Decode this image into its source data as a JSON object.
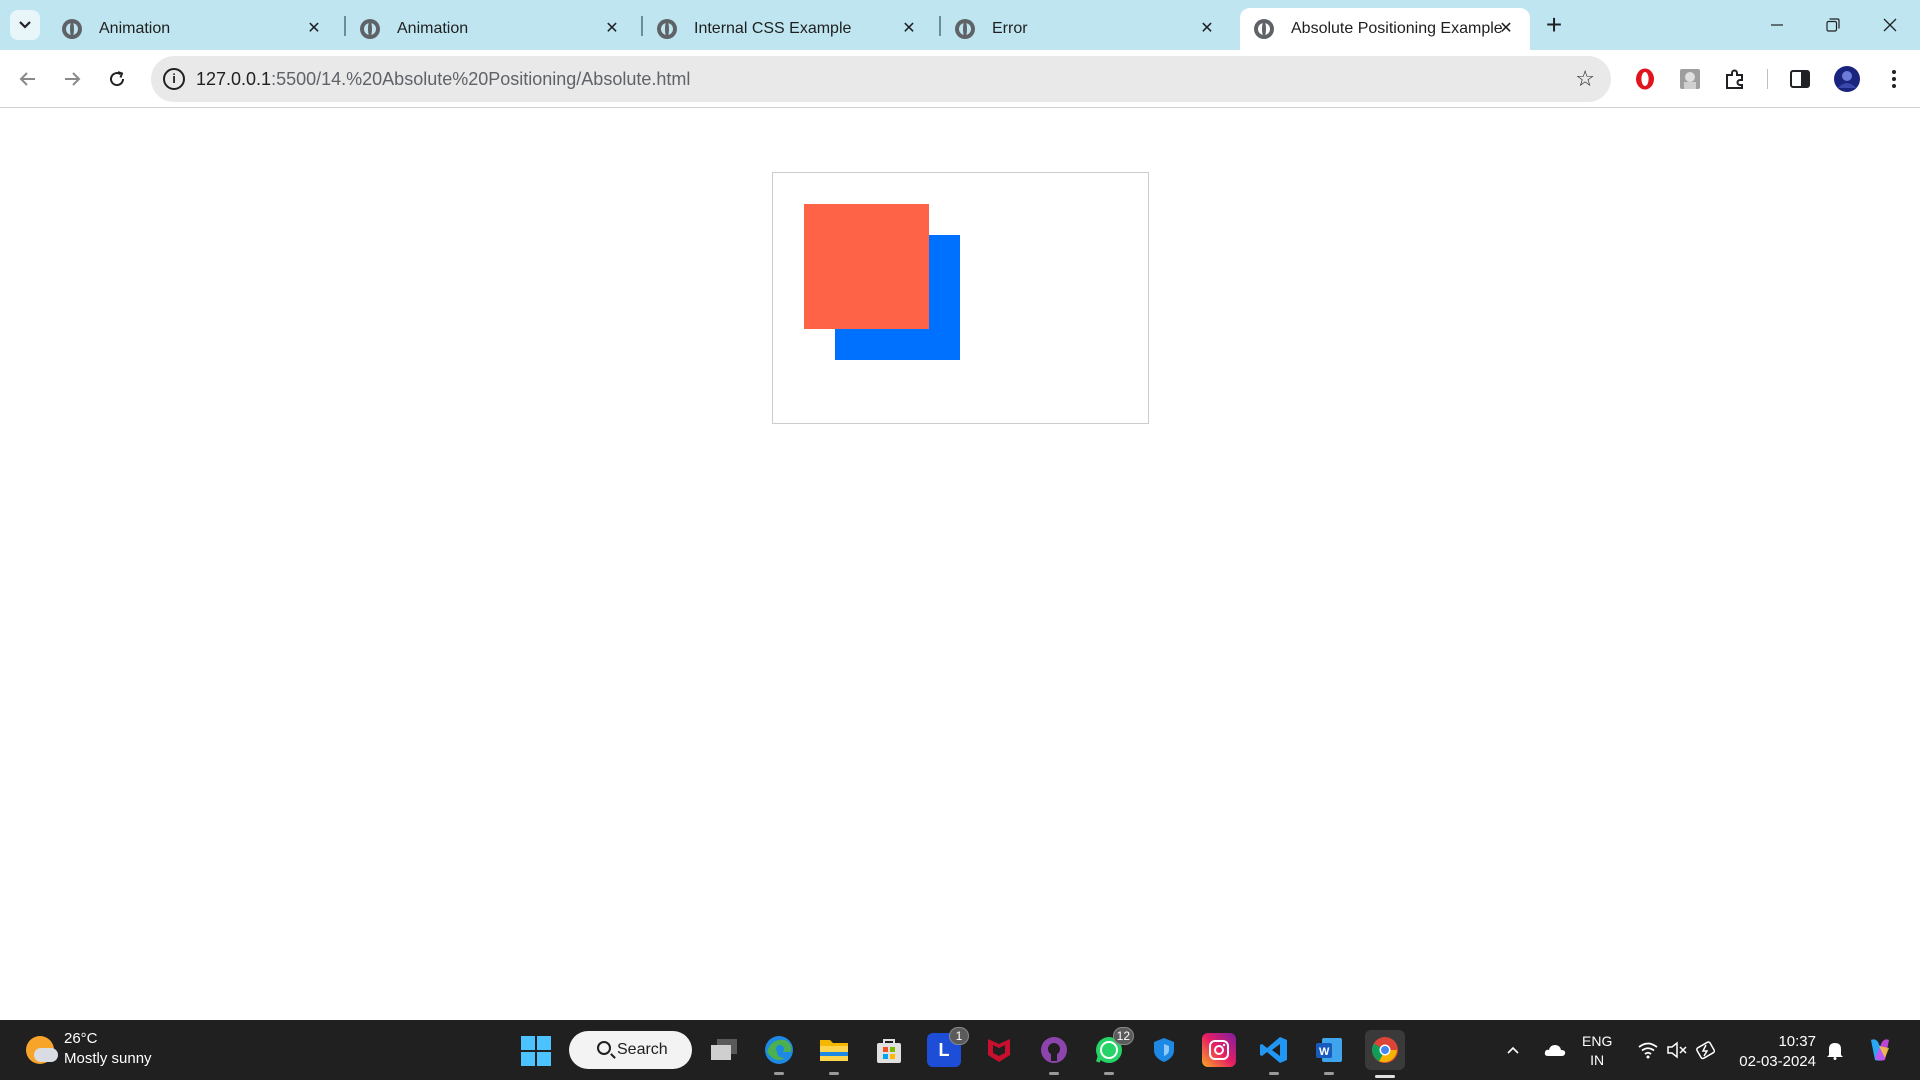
{
  "browser": {
    "tabs": [
      {
        "title": "Animation",
        "active": false
      },
      {
        "title": "Animation",
        "active": false
      },
      {
        "title": "Internal CSS Example",
        "active": false
      },
      {
        "title": "Error",
        "active": false
      },
      {
        "title": "Absolute Positioning Example",
        "active": true
      }
    ],
    "new_tab_label": "+",
    "address": {
      "host": "127.0.0.1",
      "path": ":5500/14.%20Absolute%20Positioning/Absolute.html"
    }
  },
  "page": {
    "front_box_color": "#ff6347",
    "back_box_color": "#0070ff"
  },
  "taskbar": {
    "weather": {
      "temp": "26°C",
      "desc": "Mostly sunny"
    },
    "search_label": "Search",
    "apps": [
      {
        "name": "task-view",
        "badge": ""
      },
      {
        "name": "edge",
        "badge": ""
      },
      {
        "name": "file-explorer",
        "badge": ""
      },
      {
        "name": "microsoft-store",
        "badge": ""
      },
      {
        "name": "l-app",
        "badge": "1"
      },
      {
        "name": "mcafee",
        "badge": ""
      },
      {
        "name": "github-desktop",
        "badge": ""
      },
      {
        "name": "whatsapp",
        "badge": "12"
      },
      {
        "name": "defender",
        "badge": ""
      },
      {
        "name": "instagram",
        "badge": ""
      },
      {
        "name": "vscode",
        "badge": ""
      },
      {
        "name": "word",
        "badge": ""
      },
      {
        "name": "chrome",
        "badge": ""
      }
    ],
    "language": {
      "line1": "ENG",
      "line2": "IN"
    },
    "clock": {
      "time": "10:37",
      "date": "02-03-2024"
    }
  }
}
